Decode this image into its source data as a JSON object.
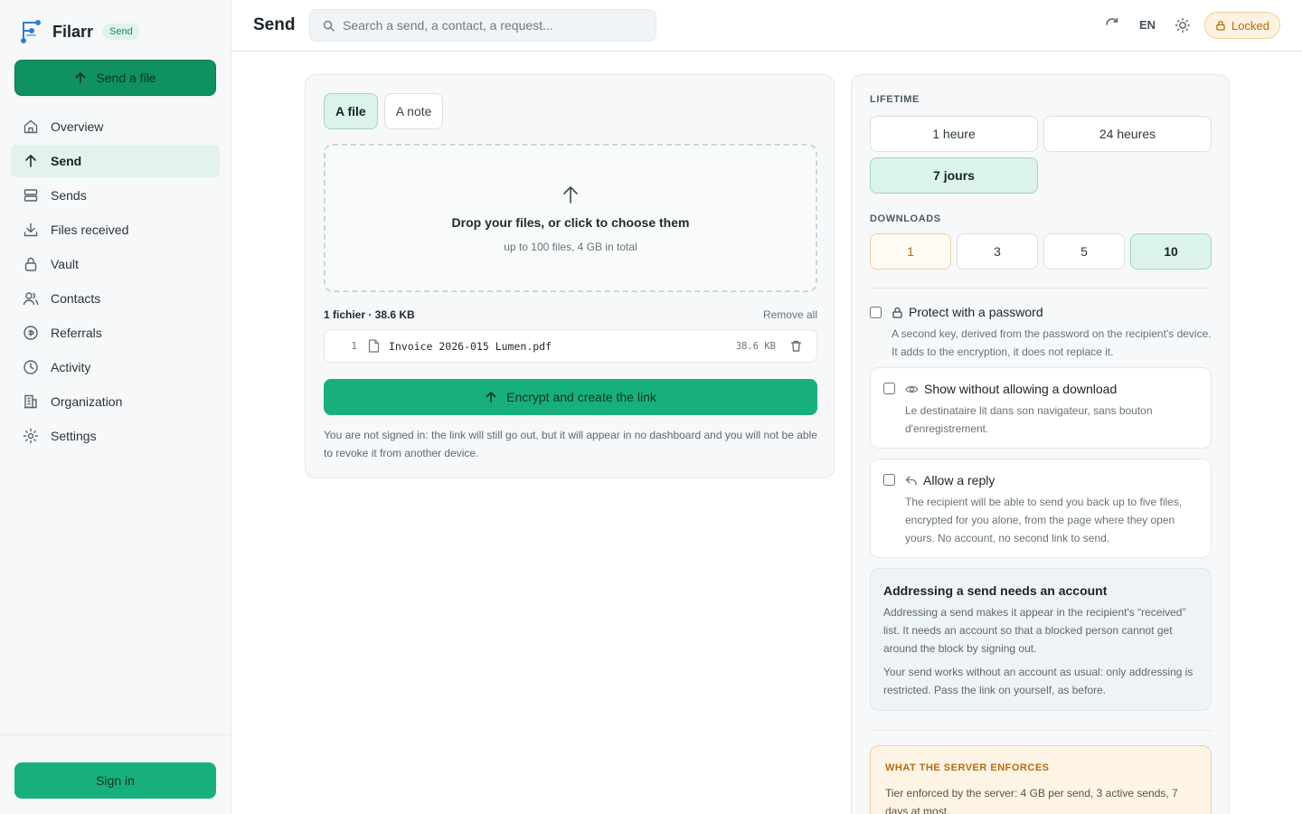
{
  "app": {
    "name": "Filarr",
    "badge": "Send"
  },
  "sidebar": {
    "send_file_label": "Send a file",
    "items": [
      {
        "label": "Overview",
        "icon": "home-icon"
      },
      {
        "label": "Send",
        "icon": "arrow-up-icon",
        "active": true
      },
      {
        "label": "Sends",
        "icon": "list-icon"
      },
      {
        "label": "Files received",
        "icon": "download-icon"
      },
      {
        "label": "Vault",
        "icon": "lock-icon"
      },
      {
        "label": "Contacts",
        "icon": "users-icon"
      },
      {
        "label": "Referrals",
        "icon": "gift-icon"
      },
      {
        "label": "Activity",
        "icon": "clock-icon"
      },
      {
        "label": "Organization",
        "icon": "building-icon"
      },
      {
        "label": "Settings",
        "icon": "gear-icon"
      }
    ],
    "signin_label": "Sign in"
  },
  "header": {
    "title": "Send",
    "search_placeholder": "Search a send, a contact, a request...",
    "lang": "EN",
    "locked_label": "Locked"
  },
  "compose": {
    "tabs": [
      {
        "label": "A file",
        "active": true
      },
      {
        "label": "A note",
        "active": false
      }
    ],
    "dropzone_title": "Drop your files, or click to choose them",
    "dropzone_sub": "up to 100 files, 4 GB in total",
    "files_summary": "1 fichier · 38.6 KB",
    "remove_all": "Remove all",
    "files": [
      {
        "index": "1",
        "name": "Invoice 2026-015 Lumen.pdf",
        "size": "38.6 KB"
      }
    ],
    "encrypt_label": "Encrypt and create the link",
    "unsigned_note": "You are not signed in: the link will still go out, but it will appear in no dashboard and you will not be able to revoke it from another device."
  },
  "options": {
    "lifetime_label": "LIFETIME",
    "lifetime": [
      {
        "label": "1 heure",
        "selected": false
      },
      {
        "label": "24 heures",
        "selected": false
      },
      {
        "label": "7 jours",
        "selected": true
      }
    ],
    "downloads_label": "DOWNLOADS",
    "downloads": [
      {
        "label": "1",
        "selected": false,
        "warn": true
      },
      {
        "label": "3",
        "selected": false
      },
      {
        "label": "5",
        "selected": false
      },
      {
        "label": "10",
        "selected": true
      }
    ],
    "password": {
      "title": "Protect with a password",
      "desc1": "A second key, derived from the password on the recipient's device.",
      "desc2": "It adds to the encryption, it does not replace it."
    },
    "view_only": {
      "title": "Show without allowing a download",
      "desc1": "Le destinataire lit dans son navigateur, sans bouton",
      "desc2": "d'enregistrement."
    },
    "reply": {
      "title": "Allow a reply",
      "desc": "The recipient will be able to send you back up to five files, encrypted for you alone, from the page where they open yours. No account, no second link to send."
    },
    "account_notice": {
      "title": "Addressing a send needs an account",
      "p1": "Addressing a send makes it appear in the recipient's “received” list. It needs an account so that a blocked person cannot get around the block by signing out.",
      "p2": "Your send works without an account as usual: only addressing is restricted. Pass the link on yourself, as before."
    },
    "server": {
      "title": "WHAT THE SERVER ENFORCES",
      "text": "Tier enforced by the server: 4 GB per send, 3 active sends, 7 days at most."
    }
  },
  "colors": {
    "brand_green": "#0f9160",
    "accent_green": "#18b07a",
    "selected_bg": "#dcf3e9",
    "warn_orange": "#b76b0f",
    "warn_bg": "#fdf4e6"
  }
}
